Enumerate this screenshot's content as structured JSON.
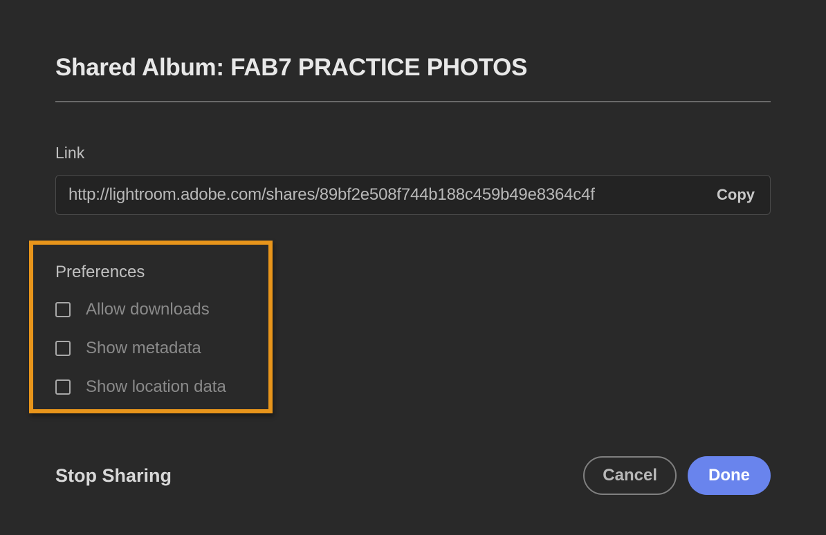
{
  "dialog": {
    "title": "Shared Album: FAB7 PRACTICE PHOTOS"
  },
  "link": {
    "label": "Link",
    "url": "http://lightroom.adobe.com/shares/89bf2e508f744b188c459b49e8364c4f",
    "copy_label": "Copy"
  },
  "preferences": {
    "label": "Preferences",
    "options": [
      {
        "label": "Allow downloads",
        "checked": false
      },
      {
        "label": "Show metadata",
        "checked": false
      },
      {
        "label": "Show location data",
        "checked": false
      }
    ]
  },
  "actions": {
    "stop_sharing": "Stop Sharing",
    "cancel": "Cancel",
    "done": "Done"
  },
  "highlight": {
    "color": "#e8951b"
  }
}
